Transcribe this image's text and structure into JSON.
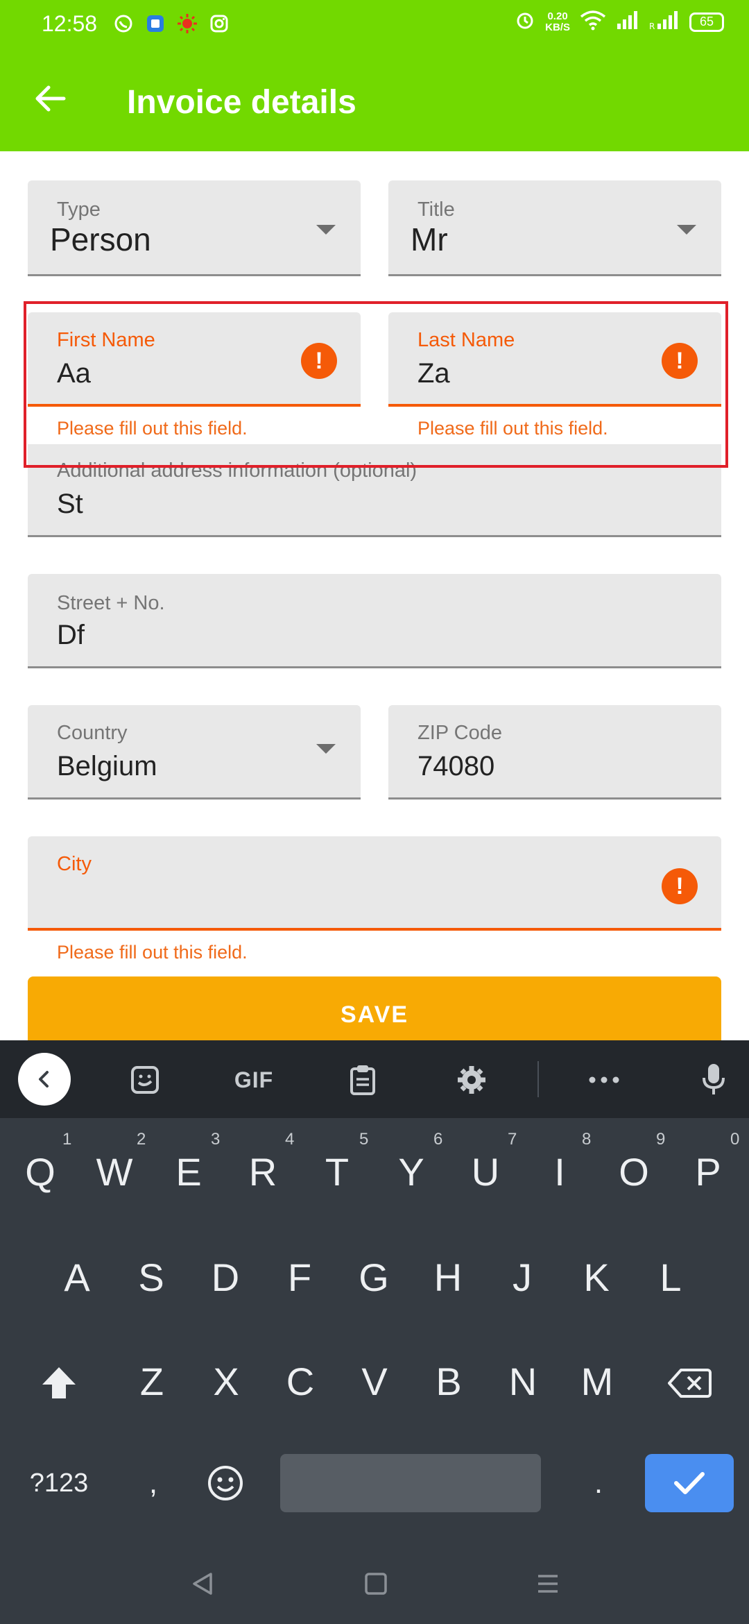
{
  "status_bar": {
    "time": "12:58",
    "speed_value": "0.20",
    "speed_unit": "KB/S",
    "battery": "65"
  },
  "app_bar": {
    "title": "Invoice details"
  },
  "form": {
    "type": {
      "label": "Type",
      "value": "Person"
    },
    "title": {
      "label": "Title",
      "value": "Mr"
    },
    "first_name": {
      "label": "First Name",
      "value": "Aa",
      "error": "Please fill out this field."
    },
    "last_name": {
      "label": "Last Name",
      "value": "Za",
      "error": "Please fill out this field."
    },
    "additional_address": {
      "label": "Additional address information (optional)",
      "value": "St"
    },
    "street": {
      "label": "Street + No.",
      "value": "Df"
    },
    "country": {
      "label": "Country",
      "value": "Belgium"
    },
    "zip": {
      "label": "ZIP Code",
      "value": "74080"
    },
    "city": {
      "label": "City",
      "value": "",
      "error": "Please fill out this field."
    },
    "save_label": "SAVE"
  },
  "keyboard": {
    "gif_label": "GIF",
    "row1": [
      "Q",
      "W",
      "E",
      "R",
      "T",
      "Y",
      "U",
      "I",
      "O",
      "P"
    ],
    "row1_hints": [
      "1",
      "2",
      "3",
      "4",
      "5",
      "6",
      "7",
      "8",
      "9",
      "0"
    ],
    "row2": [
      "A",
      "S",
      "D",
      "F",
      "G",
      "H",
      "J",
      "K",
      "L"
    ],
    "row3": [
      "Z",
      "X",
      "C",
      "V",
      "B",
      "N",
      "M"
    ],
    "symbols_label": "?123",
    "comma": ",",
    "period": "."
  },
  "colors": {
    "app_bar": "#72d900",
    "error": "#f55a08",
    "save_button": "#f8aa04",
    "keyboard_bg": "#353b42",
    "enter_key": "#4a8ef0"
  }
}
